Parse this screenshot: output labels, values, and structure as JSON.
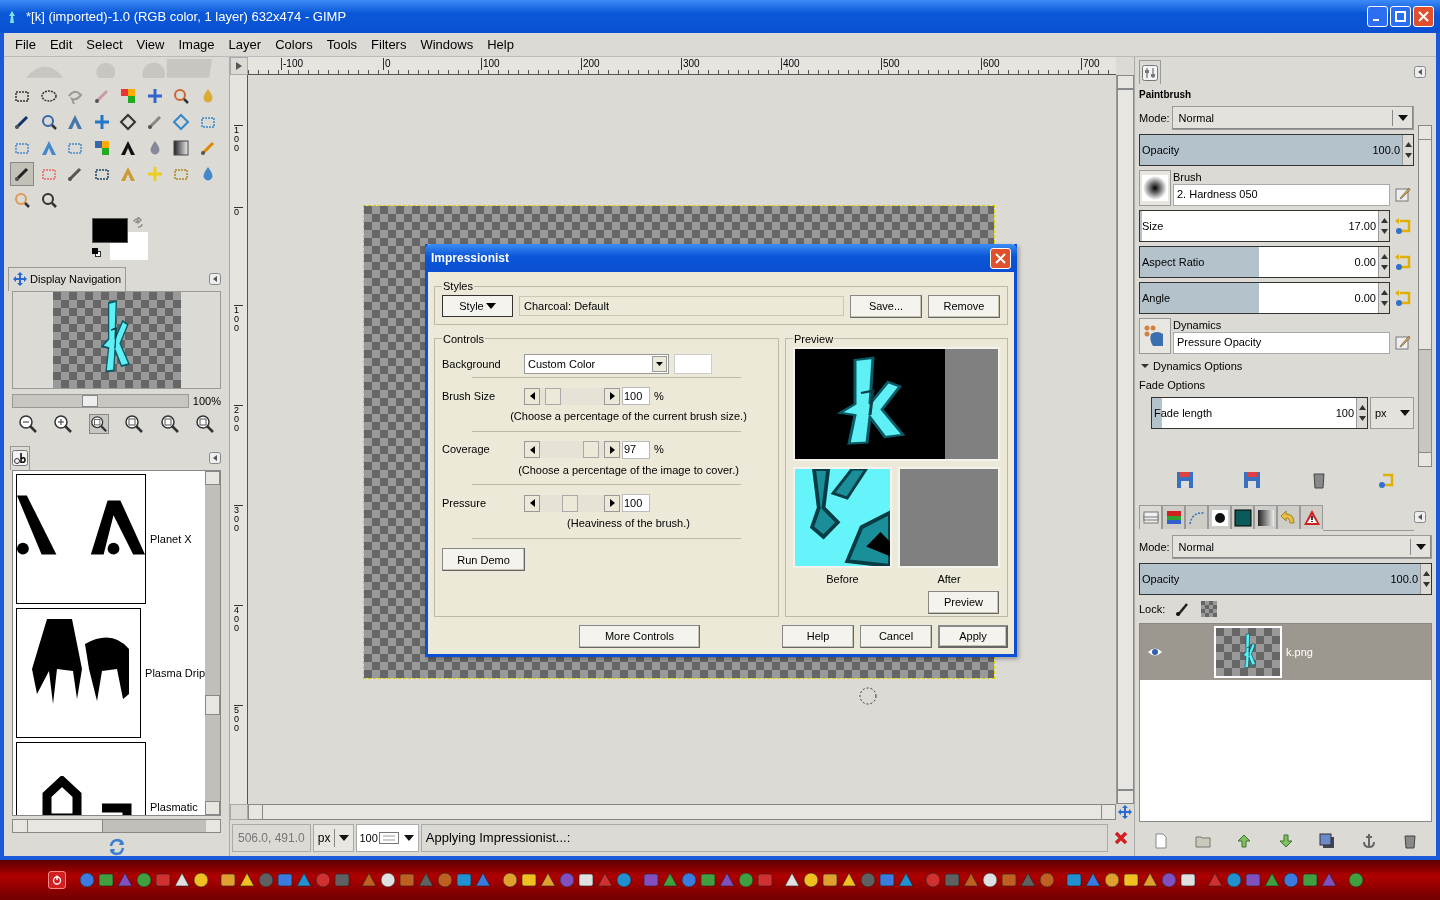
{
  "window": {
    "title": "*[k] (imported)-1.0 (RGB color, 1 layer) 632x474 - GIMP"
  },
  "menu": [
    "File",
    "Edit",
    "Select",
    "View",
    "Image",
    "Layer",
    "Colors",
    "Tools",
    "Filters",
    "Windows",
    "Help"
  ],
  "toolbox": {
    "tools": [
      {
        "selected": false
      },
      {
        "selected": false
      },
      {
        "selected": false
      },
      {
        "selected": false
      },
      {
        "selected": false
      },
      {
        "selected": false
      },
      {
        "selected": false
      },
      {
        "selected": false
      },
      {
        "selected": false
      },
      {
        "selected": false
      },
      {
        "selected": false
      },
      {
        "selected": false
      },
      {
        "selected": false
      },
      {
        "selected": false
      },
      {
        "selected": false
      },
      {
        "selected": false
      },
      {
        "selected": false
      },
      {
        "selected": false
      },
      {
        "selected": false
      },
      {
        "selected": false
      },
      {
        "selected": false
      },
      {
        "selected": false
      },
      {
        "selected": false
      },
      {
        "selected": false
      },
      {
        "selected": true
      },
      {
        "selected": false
      },
      {
        "selected": false
      },
      {
        "selected": false
      },
      {
        "selected": false
      },
      {
        "selected": false
      },
      {
        "selected": false
      },
      {
        "selected": false
      },
      {
        "selected": false
      },
      {
        "selected": false
      }
    ]
  },
  "navigation": {
    "title": "Display Navigation",
    "zoom": "100%",
    "level": 0.42
  },
  "fonts": {
    "items": [
      {
        "name": "Planet X"
      },
      {
        "name": "Plasma Drip"
      },
      {
        "name": "Plasmatic"
      }
    ]
  },
  "rulers": {
    "horizontal": [
      "-100",
      "0",
      "100",
      "200",
      "300",
      "400",
      "500",
      "600",
      "700"
    ],
    "vertical": [
      "100",
      "0",
      "100",
      "200",
      "300",
      "400",
      "500"
    ]
  },
  "dialog": {
    "title": "Impressionist",
    "styles": {
      "label": "Styles",
      "button": "Style",
      "value": "Charcoal: Default",
      "save": "Save...",
      "remove": "Remove"
    },
    "controls": {
      "label": "Controls",
      "background_label": "Background",
      "background": "Custom Color",
      "sliders": [
        {
          "label": "Brush Size",
          "value": "100",
          "unit": "%",
          "hint": "(Choose a percentage of the current brush size.)",
          "level": 0.1
        },
        {
          "label": "Coverage",
          "value": "97",
          "unit": "%",
          "hint": "(Choose a percentage of the image to cover.)",
          "level": 0.9
        },
        {
          "label": "Pressure",
          "value": "100",
          "hint": "(Heaviness of the brush.)",
          "level": 0.45
        }
      ],
      "run_demo": "Run Demo"
    },
    "preview": {
      "label": "Preview",
      "before": "Before",
      "after": "After",
      "button": "Preview"
    },
    "buttons": [
      "More Controls",
      "Help",
      "Cancel",
      "Apply"
    ]
  },
  "status": {
    "coords": "506.0, 491.0",
    "unit": "px",
    "zoom": "100",
    "message": "Applying Impressionist...:"
  },
  "tool_options": {
    "title": "Paintbrush",
    "mode_label": "Mode:",
    "mode": "Normal",
    "opacity": {
      "label": "Opacity",
      "value": "100.0",
      "level": 1
    },
    "brush_label": "Brush",
    "brush": "2. Hardness 050",
    "size": {
      "label": "Size",
      "value": "17.00",
      "level": 0.01
    },
    "aspect": {
      "label": "Aspect Ratio",
      "value": "0.00",
      "level": 0.5
    },
    "angle": {
      "label": "Angle",
      "value": "0.00",
      "level": 0.5
    },
    "dynamics_label": "Dynamics",
    "dynamics": "Pressure Opacity",
    "dynamics_options": {
      "label": "Dynamics Options",
      "expanded": true
    },
    "fade_label": "Fade Options",
    "fade": {
      "label": "Fade length",
      "value": "100",
      "level": 0.05
    },
    "fade_unit": "px"
  },
  "layers": {
    "tabs": [
      {
        "selected": true
      },
      {
        "selected": false
      },
      {
        "selected": false
      },
      {
        "selected": false
      },
      {
        "selected": false
      },
      {
        "selected": false
      },
      {
        "selected": false
      },
      {
        "selected": false
      }
    ],
    "mode_label": "Mode:",
    "mode": "Normal",
    "opacity": {
      "label": "Opacity",
      "value": "100.0",
      "level": 1
    },
    "lock_label": "Lock:",
    "items": [
      {
        "name": "k.png",
        "selected": true,
        "visible": true
      }
    ]
  }
}
